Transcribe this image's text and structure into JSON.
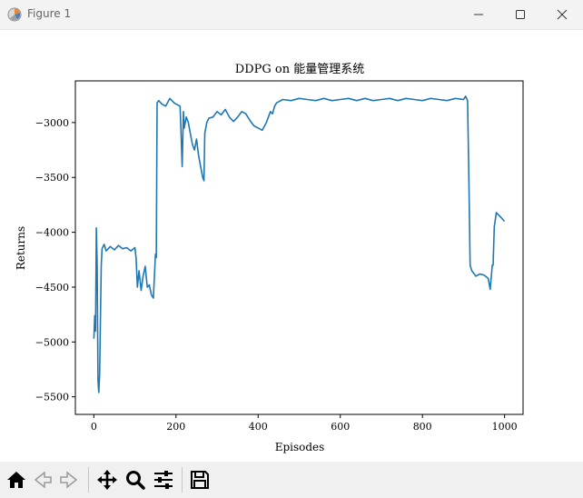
{
  "window": {
    "title": "Figure 1"
  },
  "icons": {
    "app": "matplotlib-figure-icon",
    "minimize": "minimize-icon",
    "maximize": "maximize-icon",
    "close": "close-icon",
    "home": "home-icon",
    "back": "arrow-left-icon",
    "forward": "arrow-right-icon",
    "pan": "move-arrows-icon",
    "zoom": "magnifier-icon",
    "configure": "sliders-icon",
    "save": "floppy-disk-icon"
  },
  "chart_data": {
    "type": "line",
    "title": "DDPG on 能量管理系统",
    "xlabel": "Episodes",
    "ylabel": "Returns",
    "xlim": [
      -45,
      1045
    ],
    "ylim": [
      -5660,
      -2620
    ],
    "xticks": [
      0,
      200,
      400,
      600,
      800,
      1000
    ],
    "yticks": [
      -3000,
      -3500,
      -4000,
      -4500,
      -5000,
      -5500
    ],
    "grid": false,
    "line_color": "#1f77b4",
    "series": [
      {
        "x": [
          0,
          2,
          4,
          6,
          8,
          10,
          12,
          14,
          16,
          18,
          20,
          25,
          30,
          40,
          50,
          60,
          70,
          80,
          90,
          100,
          103,
          106,
          110,
          115,
          120,
          125,
          130,
          135,
          140,
          145,
          150,
          152,
          154,
          158,
          165,
          175,
          185,
          195,
          200,
          205,
          210,
          212,
          215,
          218,
          220,
          225,
          230,
          235,
          240,
          245,
          250,
          255,
          260,
          265,
          268,
          270,
          275,
          280,
          290,
          300,
          310,
          320,
          330,
          340,
          350,
          360,
          370,
          380,
          390,
          400,
          410,
          420,
          430,
          435,
          440,
          445,
          450,
          460,
          480,
          500,
          520,
          540,
          560,
          580,
          600,
          620,
          640,
          660,
          680,
          700,
          720,
          740,
          760,
          780,
          800,
          820,
          840,
          860,
          880,
          900,
          905,
          910,
          913,
          916,
          920,
          930,
          940,
          950,
          960,
          965,
          970,
          972,
          975,
          980,
          990,
          1000
        ],
        "y": [
          -4970,
          -4760,
          -4900,
          -3960,
          -4300,
          -5350,
          -5460,
          -5300,
          -4800,
          -4300,
          -4150,
          -4110,
          -4170,
          -4130,
          -4160,
          -4120,
          -4150,
          -4140,
          -4170,
          -4140,
          -4240,
          -4500,
          -4350,
          -4530,
          -4400,
          -4310,
          -4500,
          -4480,
          -4570,
          -4600,
          -4200,
          -4230,
          -2820,
          -2800,
          -2830,
          -2850,
          -2780,
          -2820,
          -2830,
          -2840,
          -2850,
          -3050,
          -3400,
          -2900,
          -3050,
          -2950,
          -3000,
          -3100,
          -3200,
          -3250,
          -3150,
          -3300,
          -3400,
          -3500,
          -3530,
          -3100,
          -3000,
          -2960,
          -2950,
          -2900,
          -2930,
          -2880,
          -2950,
          -2990,
          -2950,
          -2900,
          -2920,
          -2980,
          -3030,
          -3050,
          -3070,
          -3000,
          -2900,
          -2920,
          -2850,
          -2820,
          -2810,
          -2790,
          -2800,
          -2780,
          -2790,
          -2800,
          -2780,
          -2800,
          -2790,
          -2780,
          -2800,
          -2780,
          -2800,
          -2790,
          -2780,
          -2800,
          -2780,
          -2790,
          -2800,
          -2780,
          -2790,
          -2800,
          -2780,
          -2790,
          -2760,
          -2800,
          -3500,
          -4300,
          -4350,
          -4400,
          -4380,
          -4390,
          -4420,
          -4520,
          -4300,
          -4300,
          -3950,
          -3820,
          -3860,
          -3900
        ]
      }
    ]
  }
}
